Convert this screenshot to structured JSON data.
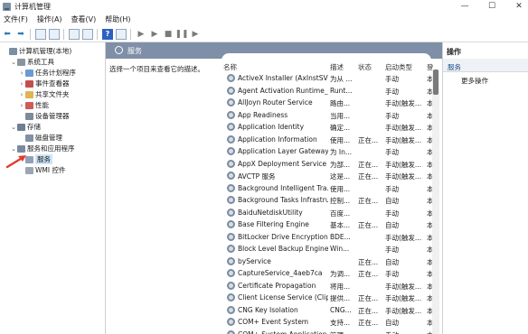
{
  "window": {
    "title": "计算机管理",
    "minimize": "—",
    "maximize": "☐",
    "close": "✕"
  },
  "menu": [
    "文件(F)",
    "操作(A)",
    "查看(V)",
    "帮助(H)"
  ],
  "toolbar": {
    "help_label": "?"
  },
  "tree": [
    {
      "label": "计算机管理(本地)",
      "expander": "",
      "icon_color": "#7b8fa3",
      "indent": 0
    },
    {
      "label": "系统工具",
      "expander": "⌄",
      "icon_color": "#8a94a0",
      "indent": 1
    },
    {
      "label": "任务计划程序",
      "expander": "›",
      "icon_color": "#6a9bd1",
      "indent": 2
    },
    {
      "label": "事件查看器",
      "expander": "›",
      "icon_color": "#c44e4e",
      "indent": 2
    },
    {
      "label": "共享文件夹",
      "expander": "›",
      "icon_color": "#e0b450",
      "indent": 2
    },
    {
      "label": "性能",
      "expander": "›",
      "icon_color": "#d05a5a",
      "indent": 2
    },
    {
      "label": "设备管理器",
      "expander": "",
      "icon_color": "#7c8a9a",
      "indent": 2
    },
    {
      "label": "存储",
      "expander": "⌄",
      "icon_color": "#6f7f92",
      "indent": 1
    },
    {
      "label": "磁盘管理",
      "expander": "",
      "icon_color": "#8190a4",
      "indent": 2
    },
    {
      "label": "服务和应用程序",
      "expander": "⌄",
      "icon_color": "#7a8aa0",
      "indent": 1
    },
    {
      "label": "服务",
      "expander": "",
      "icon_color": "#90a0b6",
      "indent": 2,
      "selected": true
    },
    {
      "label": "WMI 控件",
      "expander": "",
      "icon_color": "#9aa6b4",
      "indent": 2
    }
  ],
  "center": {
    "header": "服务",
    "description": "选择一个项目来查看它的描述。",
    "columns": {
      "name": "名称",
      "desc": "描述",
      "status": "状态",
      "startup": "启动类型",
      "login": "登"
    }
  },
  "services": [
    {
      "name": "ActiveX Installer (AxInstSV)",
      "desc": "为从 ...",
      "status": "",
      "startup": "手动",
      "login": "本"
    },
    {
      "name": "Agent Activation Runtime_...",
      "desc": "Runt...",
      "status": "",
      "startup": "手动",
      "login": "本"
    },
    {
      "name": "AllJoyn Router Service",
      "desc": "路由...",
      "status": "",
      "startup": "手动(触发...",
      "login": "本"
    },
    {
      "name": "App Readiness",
      "desc": "当用...",
      "status": "",
      "startup": "手动",
      "login": "本"
    },
    {
      "name": "Application Identity",
      "desc": "确定...",
      "status": "",
      "startup": "手动(触发...",
      "login": "本"
    },
    {
      "name": "Application Information",
      "desc": "使用...",
      "status": "正在...",
      "startup": "手动(触发...",
      "login": "本"
    },
    {
      "name": "Application Layer Gateway ...",
      "desc": "为 In...",
      "status": "",
      "startup": "手动",
      "login": "本"
    },
    {
      "name": "AppX Deployment Service ...",
      "desc": "为部...",
      "status": "正在...",
      "startup": "手动(触发...",
      "login": "本"
    },
    {
      "name": "AVCTP 服务",
      "desc": "这是...",
      "status": "正在...",
      "startup": "手动(触发...",
      "login": "本"
    },
    {
      "name": "Background Intelligent Tra...",
      "desc": "使用...",
      "status": "",
      "startup": "手动",
      "login": "本"
    },
    {
      "name": "Background Tasks Infrastru...",
      "desc": "控制...",
      "status": "正在...",
      "startup": "自动",
      "login": "本"
    },
    {
      "name": "BaiduNetdiskUtility",
      "desc": "百度...",
      "status": "",
      "startup": "手动",
      "login": "本"
    },
    {
      "name": "Base Filtering Engine",
      "desc": "基本...",
      "status": "正在...",
      "startup": "自动",
      "login": "本"
    },
    {
      "name": "BitLocker Drive Encryption ...",
      "desc": "BDE...",
      "status": "",
      "startup": "手动(触发...",
      "login": "本"
    },
    {
      "name": "Block Level Backup Engine ...",
      "desc": "Win...",
      "status": "",
      "startup": "手动",
      "login": "本"
    },
    {
      "name": "byService",
      "desc": "",
      "status": "正在...",
      "startup": "自动",
      "login": "本"
    },
    {
      "name": "CaptureService_4aeb7ca",
      "desc": "为调...",
      "status": "正在...",
      "startup": "手动",
      "login": "本"
    },
    {
      "name": "Certificate Propagation",
      "desc": "将用...",
      "status": "",
      "startup": "手动(触发...",
      "login": "本"
    },
    {
      "name": "Client License Service (Clip...",
      "desc": "提供...",
      "status": "正在...",
      "startup": "手动(触发...",
      "login": "本"
    },
    {
      "name": "CNG Key Isolation",
      "desc": "CNG...",
      "status": "正在...",
      "startup": "手动(触发...",
      "login": "本"
    },
    {
      "name": "COM+ Event System",
      "desc": "支持...",
      "status": "正在...",
      "startup": "自动",
      "login": "本"
    },
    {
      "name": "COM+ System Application",
      "desc": "管理...",
      "status": "",
      "startup": "手动",
      "login": "本"
    }
  ],
  "actions": {
    "title": "操作",
    "section": "服务",
    "more": "更多操作",
    "more_arrow": "▸"
  }
}
